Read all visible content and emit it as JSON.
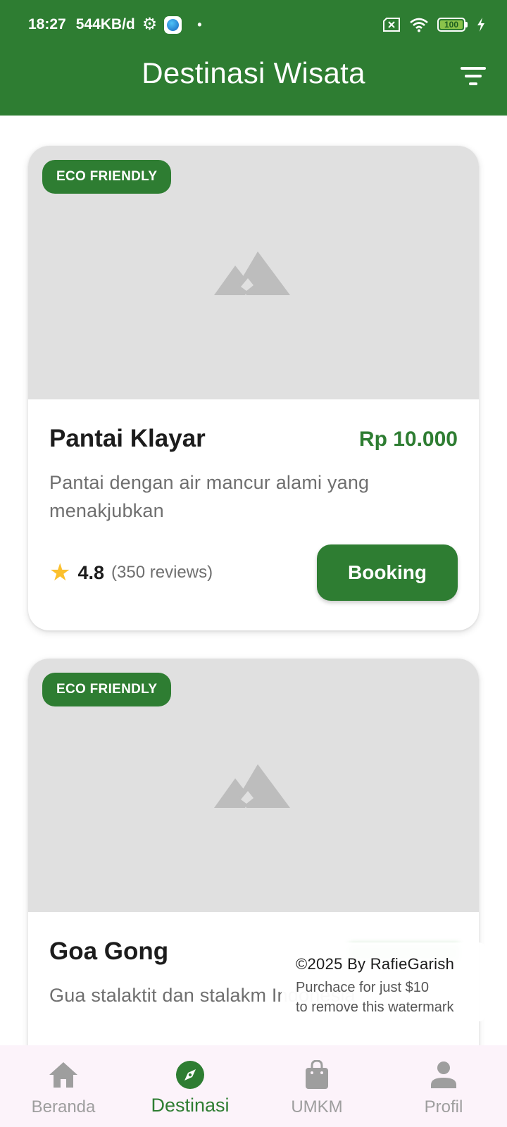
{
  "status_bar": {
    "time": "18:27",
    "network_speed": "544KB/d",
    "battery_level": "100",
    "icons": [
      "gear-icon",
      "app-notification-icon",
      "dot-icon",
      "no-sim-icon",
      "wifi-icon",
      "battery-icon",
      "charging-icon"
    ]
  },
  "app_bar": {
    "title": "Destinasi Wisata",
    "filter_icon": "filter-icon"
  },
  "destinations": [
    {
      "badge": "ECO FRIENDLY",
      "name": "Pantai Klayar",
      "price": "Rp 10.000",
      "description": "Pantai dengan air mancur alami yang menakjubkan",
      "rating": "4.8",
      "reviews": "(350 reviews)",
      "button_label": "Booking"
    },
    {
      "badge": "ECO FRIENDLY",
      "name": "Goa Gong",
      "description": "Gua stalaktit dan stalakm Indonesia"
    }
  ],
  "watermark": {
    "line1": "©2025 By RafieGarish",
    "line2": "Purchace for just $10",
    "line3": "to remove this watermark"
  },
  "bottom_nav": {
    "items": [
      {
        "label": "Beranda",
        "icon": "home-icon",
        "active": false
      },
      {
        "label": "Destinasi",
        "icon": "compass-icon",
        "active": true
      },
      {
        "label": "UMKM",
        "icon": "shopping-bag-icon",
        "active": false
      },
      {
        "label": "Profil",
        "icon": "person-icon",
        "active": false
      }
    ]
  },
  "colors": {
    "primary": "#2e7d32",
    "star": "#fbc02d",
    "image_placeholder": "#e0e0e0",
    "nav_background": "#fcf3fa",
    "inactive": "#9e9e9e"
  }
}
